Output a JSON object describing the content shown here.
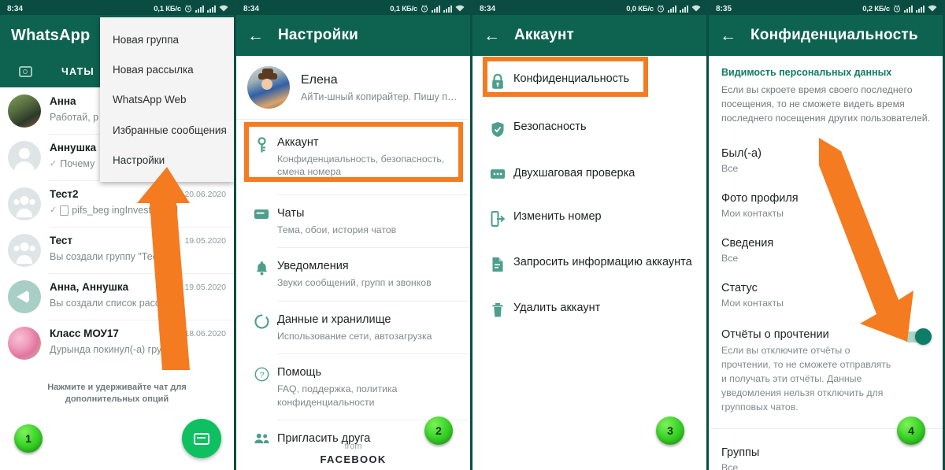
{
  "colors": {
    "header_green": "#0d6350",
    "status_bar": "#0a4c41",
    "accent_teal": "#4d9e8c",
    "highlight_orange": "#f47b20",
    "badge_green": "#3ed62c",
    "fab_green": "#0ec062"
  },
  "panel1": {
    "status": {
      "time": "8:34",
      "speed": "0,1 КБ/c"
    },
    "app_title": "WhatsApp",
    "tabs": {
      "camera_icon": "camera-icon",
      "chats_label": "ЧАТЫ"
    },
    "menu": {
      "items": [
        "Новая группа",
        "Новая рассылка",
        "WhatsApp Web",
        "Избранные сообщения",
        "Настройки"
      ]
    },
    "chats": [
      {
        "name": "Анна",
        "message": "Работай, р",
        "date": "",
        "tick": false,
        "doc": false,
        "avatar": "photo-woman"
      },
      {
        "name": "Аннушка",
        "message": "Почему",
        "date": "",
        "tick": true,
        "doc": false,
        "avatar": "person"
      },
      {
        "name": "Тест2",
        "message": "pifs_beg     ingInvestor.psd",
        "date": "20.06.2020",
        "tick": true,
        "doc": true,
        "avatar": "group"
      },
      {
        "name": "Тест",
        "message": "Вы создали группу \"Тест \"",
        "date": "19.05.2020",
        "tick": false,
        "doc": false,
        "avatar": "group"
      },
      {
        "name": "Анна, Аннушка",
        "message": "Вы создали список рассылки с 2 п...",
        "date": "19.05.2020",
        "tick": false,
        "doc": false,
        "avatar": "broadcast"
      },
      {
        "name": "Класс МОУ17",
        "message": "Дурында покинул(-а) группу",
        "date": "18.06.2020",
        "tick": false,
        "doc": false,
        "avatar": "photo-flowers"
      }
    ],
    "hint": "Нажмите и удерживайте чат для дополнительных опций",
    "fab_icon": "new-chat-icon",
    "step_badge": "1"
  },
  "panel2": {
    "status": {
      "time": "8:34",
      "speed": "0,1 КБ/c"
    },
    "back_icon": "back-arrow-icon",
    "title": "Настройки",
    "profile": {
      "name": "Елена",
      "status": "АйТи-шный копирайтер. Пишу прост..."
    },
    "items": [
      {
        "icon": "key-icon",
        "title": "Аккаунт",
        "subtitle": "Конфиденциальность, безопасность, смена номера",
        "highlighted": true
      },
      {
        "icon": "chat-icon",
        "title": "Чаты",
        "subtitle": "Тема, обои, история чатов",
        "highlighted": false
      },
      {
        "icon": "bell-icon",
        "title": "Уведомления",
        "subtitle": "Звуки сообщений, групп и звонков",
        "highlighted": false
      },
      {
        "icon": "data-icon",
        "title": "Данные и хранилище",
        "subtitle": "Использование сети, автозагрузка",
        "highlighted": false
      },
      {
        "icon": "help-icon",
        "title": "Помощь",
        "subtitle": "FAQ, поддержка, политика конфиденциальности",
        "highlighted": false
      },
      {
        "icon": "invite-icon",
        "title": "Пригласить друга",
        "subtitle": "",
        "highlighted": false
      }
    ],
    "footer": {
      "from": "from",
      "brand": "FACEBOOK"
    },
    "step_badge": "2"
  },
  "panel3": {
    "status": {
      "time": "8:34",
      "speed": "0,0 КБ/c"
    },
    "back_icon": "back-arrow-icon",
    "title": "Аккаунт",
    "items": [
      {
        "icon": "lock-icon",
        "title": "Конфиденциальность",
        "highlighted": true
      },
      {
        "icon": "shield-icon",
        "title": "Безопасность",
        "highlighted": false
      },
      {
        "icon": "dots-icon",
        "title": "Двухшаговая проверка",
        "highlighted": false
      },
      {
        "icon": "exit-icon",
        "title": "Изменить номер",
        "highlighted": false
      },
      {
        "icon": "file-icon",
        "title": "Запросить информацию аккаунта",
        "highlighted": false
      },
      {
        "icon": "trash-icon",
        "title": "Удалить аккаунт",
        "highlighted": false
      }
    ],
    "step_badge": "3"
  },
  "panel4": {
    "status": {
      "time": "8:35",
      "speed": "0,2 КБ/c"
    },
    "back_icon": "back-arrow-icon",
    "title": "Конфиденциальность",
    "section_title": "Видимость персональных данных",
    "section_desc": "Если вы скроете время своего последнего посещения, то не сможете видеть время последнего посещения других пользователей.",
    "rows": [
      {
        "title": "Был(-а)",
        "value": "Все"
      },
      {
        "title": "Фото профиля",
        "value": "Мои контакты"
      },
      {
        "title": "Сведения",
        "value": "Все"
      },
      {
        "title": "Статус",
        "value": "Мои контакты"
      }
    ],
    "read_receipts": {
      "title": "Отчёты о прочтении",
      "desc": "Если вы отключите отчёты о прочтении, то не сможете отправлять и получать эти отчёты. Данные уведомления нельзя отключить для групповых чатов.",
      "toggle_on": true
    },
    "groups": {
      "title": "Группы",
      "value": "Все"
    },
    "step_badge": "4"
  }
}
